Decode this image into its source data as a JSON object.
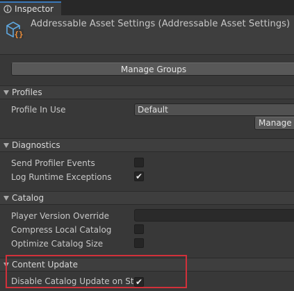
{
  "tab": {
    "label": "Inspector",
    "icon": "info-icon"
  },
  "header": {
    "title": "Addressable Asset Settings (Addressable Asset Settings)",
    "icon": "addressable-settings-asset-icon"
  },
  "manage_groups_label": "Manage Groups",
  "sections": {
    "profiles": "Profiles",
    "diagnostics": "Diagnostics",
    "catalog": "Catalog",
    "content_update": "Content Update"
  },
  "profiles": {
    "profile_in_use_label": "Profile In Use",
    "profile_in_use_value": "Default",
    "manage_label": "Manage"
  },
  "diagnostics": {
    "send_profiler_events": {
      "label": "Send Profiler Events",
      "checked": false
    },
    "log_runtime_exceptions": {
      "label": "Log Runtime Exceptions",
      "checked": true
    }
  },
  "catalog": {
    "player_version_override": {
      "label": "Player Version Override",
      "value": ""
    },
    "compress_local_catalog": {
      "label": "Compress Local Catalog",
      "checked": false
    },
    "optimize_catalog_size": {
      "label": "Optimize Catalog Size",
      "checked": false
    }
  },
  "content_update": {
    "disable_catalog_update": {
      "label": "Disable Catalog Update on Startup",
      "checked": true
    }
  },
  "colors": {
    "background": "#383838",
    "tab_accent": "#3a79bb",
    "highlight_box": "#d2303a"
  },
  "checkmark": "✔"
}
